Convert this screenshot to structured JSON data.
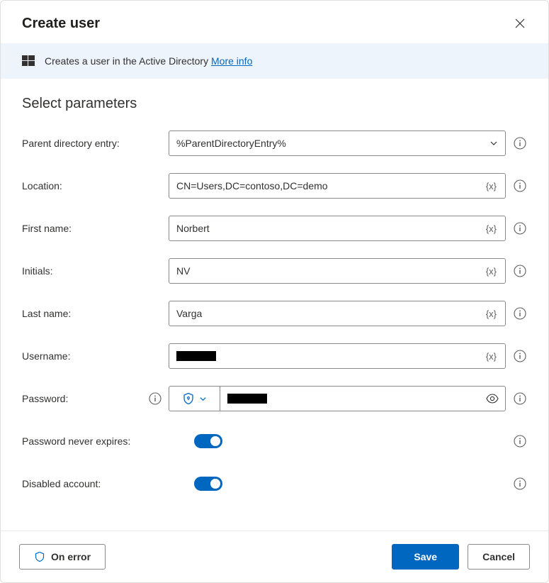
{
  "header": {
    "title": "Create user"
  },
  "banner": {
    "text": "Creates a user in the Active Directory ",
    "link": "More info"
  },
  "section": {
    "title": "Select parameters"
  },
  "fields": {
    "parentDir": {
      "label": "Parent directory entry:",
      "value": "%ParentDirectoryEntry%"
    },
    "location": {
      "label": "Location:",
      "value": "CN=Users,DC=contoso,DC=demo"
    },
    "firstName": {
      "label": "First name:",
      "value": "Norbert"
    },
    "initials": {
      "label": "Initials:",
      "value": "NV"
    },
    "lastName": {
      "label": "Last name:",
      "value": "Varga"
    },
    "username": {
      "label": "Username:",
      "value": ""
    },
    "password": {
      "label": "Password:",
      "value": ""
    },
    "neverExpires": {
      "label": "Password never expires:",
      "on": true
    },
    "disabled": {
      "label": "Disabled account:",
      "on": true
    }
  },
  "varBadge": "{x}",
  "footer": {
    "onError": "On error",
    "save": "Save",
    "cancel": "Cancel"
  }
}
